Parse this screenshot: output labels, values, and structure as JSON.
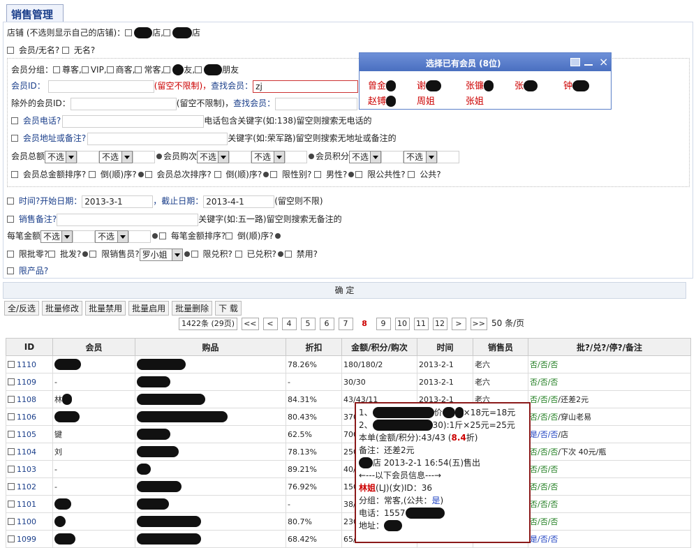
{
  "page": {
    "title": "销售管理"
  },
  "filters": {
    "store_label": "店铺 (不选则显示自己的店铺)：",
    "store_opt1_suffix": "店,",
    "store_opt2_suffix": "店",
    "member_or_anon": "会员/无名?",
    "anon": "无名?",
    "group_label": "会员分组：",
    "groups": [
      "尊客,",
      "VIP,",
      "商客,",
      "常客,",
      "友,",
      "朋友"
    ],
    "member_id_label": "会员ID：",
    "member_id_hint": "(留空不限制)，",
    "find_member_label": "查找会员：",
    "find_member_value": "zj",
    "exclude_id_label": "除外的会员ID：",
    "exclude_hint": "(留空不限制)，",
    "find_member_label2": "查找会员：",
    "phone_label": "会员电话?",
    "phone_hint": "电话包含关键字(如:138)留空则搜索无电话的",
    "addr_label": "会员地址或备注?",
    "addr_hint": "关键字(如:荣军路)留空则搜索无地址或备注的",
    "total_amount_label": "会员总额",
    "total_count_label": "会员购次",
    "points_label": "会员积分",
    "unselected": "不选",
    "sort_row": [
      "会员总金额排序?",
      "倒(顺)序?",
      "会员总次排序?",
      "倒(顺)序?",
      "限性别?",
      "男性?",
      "限公共性?",
      "公共?"
    ],
    "time_label": "时间?",
    "start_label": "开始日期：",
    "start_value": "2013-3-1",
    "end_label": "，截止日期：",
    "end_value": "2013-4-1",
    "end_hint": "(留空则不限)",
    "sales_note_label": "销售备注?",
    "sales_note_hint": "关键字(如:五一路)留空则搜索无备注的",
    "each_amount_label": "每笔金额",
    "each_sort_label": "每笔金额排序?",
    "each_desc_label": "倒(顺)序?",
    "limit_row": [
      "限批零?",
      "批发?",
      "限销售员?"
    ],
    "seller_value": "罗小姐",
    "limit_row2": [
      "限兑积?",
      "已兑积?",
      "禁用?"
    ],
    "limit_product": "限产品?",
    "confirm": "确  定"
  },
  "actions": [
    "全/反选",
    "批量修改",
    "批量禁用",
    "批量启用",
    "批量删除",
    "下 载"
  ],
  "pager": {
    "summary": "1422条 (29页)",
    "first": "<<",
    "prev": "<",
    "pages": [
      "4",
      "5",
      "6",
      "7",
      "8",
      "9",
      "10",
      "11",
      "12"
    ],
    "current": "8",
    "next": ">",
    "last": ">>",
    "per_page": "50",
    "per_unit": "条/页"
  },
  "table": {
    "headers": [
      "ID",
      "会员",
      "购品",
      "折扣",
      "金额/积分/购次",
      "时间",
      "销售员",
      "批?/兑?/停?/备注"
    ],
    "rows": [
      {
        "id": "1110",
        "member": "",
        "discount": "78.26%",
        "amount": "180/180/2",
        "time": "2013-2-1",
        "seller": "老六",
        "flags": "否/否/否",
        "note": ""
      },
      {
        "id": "1109",
        "member": "-",
        "discount": "-",
        "amount": "30/30",
        "time": "2013-2-1",
        "seller": "老六",
        "flags": "否/否/否",
        "note": ""
      },
      {
        "id": "1108",
        "member": "林",
        "discount": "84.31%",
        "amount": "43/43/11",
        "time": "2013-2-1",
        "seller": "老六",
        "flags": "否/否/否",
        "note": "/还差2元"
      },
      {
        "id": "1106",
        "member": "",
        "discount": "80.43%",
        "amount": "370",
        "time": "",
        "seller": "",
        "flags": "否/否/否",
        "note": "/穿山老易"
      },
      {
        "id": "1105",
        "member": "键",
        "discount": "62.5%",
        "amount": "700",
        "time": "",
        "seller": "",
        "flags": "是/否/否",
        "note": "/店"
      },
      {
        "id": "1104",
        "member": "刘",
        "discount": "78.13%",
        "amount": "250",
        "time": "",
        "seller": "",
        "flags": "否/否/否",
        "note": "/下次 40元/瓶"
      },
      {
        "id": "1103",
        "member": "-",
        "discount": "89.21%",
        "amount": "40/",
        "time": "",
        "seller": "",
        "flags": "否/否/否",
        "note": ""
      },
      {
        "id": "1102",
        "member": "-",
        "discount": "76.92%",
        "amount": "150",
        "time": "",
        "seller": "",
        "flags": "否/否/否",
        "note": ""
      },
      {
        "id": "1101",
        "member": "",
        "discount": "-",
        "amount": "38/",
        "time": "",
        "seller": "",
        "flags": "否/否/否",
        "note": ""
      },
      {
        "id": "1100",
        "member": "",
        "discount": "80.7%",
        "amount": "230",
        "time": "",
        "seller": "",
        "flags": "否/否/否",
        "note": ""
      },
      {
        "id": "1099",
        "member": "",
        "discount": "68.42%",
        "amount": "65/",
        "time": "",
        "seller": "",
        "flags": "是/否/否",
        "note": ""
      }
    ]
  },
  "member_popup": {
    "title": "选择已有会员 (8位)",
    "names": [
      "曾金",
      "谢",
      "张镰",
      "张",
      "钟",
      "赵镈",
      "周姐",
      "张姐"
    ]
  },
  "tooltip": {
    "line1": "1、",
    "line1b": "价",
    "line1c": "×18元=18元",
    "line2": "2、",
    "line2b": "30):1斤×25元=25元",
    "line3a": "本单(金额/积分):43/43 (",
    "line3b": "8.4",
    "line3c": "折)",
    "line4": "备注：还差2元",
    "line5": "店 2013-2-1 16:54(五)售出",
    "line6": "←---以下会员信息---→",
    "line7a": "林姐",
    "line7b": "(LJ)(女)ID：36",
    "line8a": "分组：常客,(公共：",
    "line8b": "是",
    "line8c": ")",
    "line9": "电话：1557",
    "line10": "地址："
  },
  "colors": {
    "accent_blue": "#1a3e8a",
    "hint_red": "#cc0000",
    "popup_header": "#5a7fc8",
    "tooltip_border": "#8b1a1a"
  }
}
